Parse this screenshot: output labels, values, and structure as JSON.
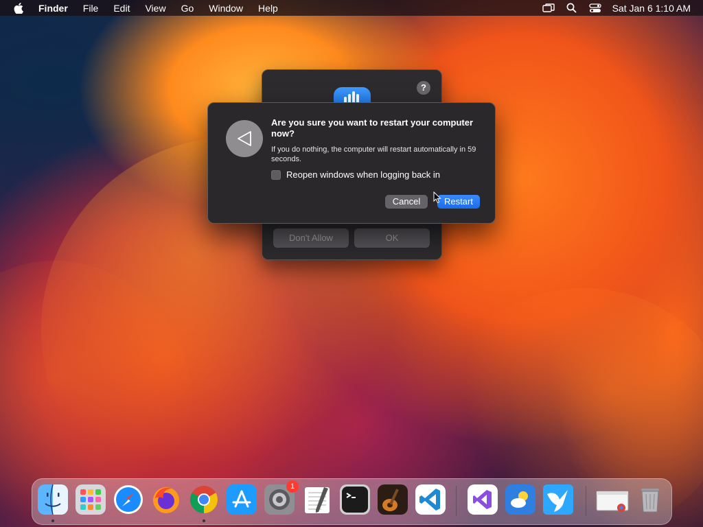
{
  "menubar": {
    "app_name": "Finder",
    "menus": [
      "File",
      "Edit",
      "View",
      "Go",
      "Window",
      "Help"
    ],
    "datetime": "Sat Jan 6  1:10 AM"
  },
  "background_dialog": {
    "help_label": "?",
    "dont_allow_label": "Don't Allow",
    "ok_label": "OK"
  },
  "restart_dialog": {
    "title": "Are you sure you want to restart your computer now?",
    "message": "If you do nothing, the computer will restart automatically in 59 seconds.",
    "checkbox_label": "Reopen windows when logging back in",
    "checkbox_checked": false,
    "cancel_label": "Cancel",
    "restart_label": "Restart"
  },
  "dock": {
    "apps": [
      {
        "name": "Finder",
        "running": true
      },
      {
        "name": "Launchpad",
        "running": false
      },
      {
        "name": "Safari",
        "running": false
      },
      {
        "name": "Firefox",
        "running": false
      },
      {
        "name": "Google Chrome",
        "running": true
      },
      {
        "name": "App Store",
        "running": false
      },
      {
        "name": "System Settings",
        "running": false,
        "badge": "1"
      },
      {
        "name": "TextEdit",
        "running": false
      },
      {
        "name": "Terminal",
        "running": false
      },
      {
        "name": "GarageBand",
        "running": false
      },
      {
        "name": "Visual Studio Code",
        "running": false
      },
      {
        "name": "Visual Studio",
        "running": false
      },
      {
        "name": "Weather",
        "running": false
      },
      {
        "name": "Hummingbird",
        "running": false
      },
      {
        "name": "Chrome Window",
        "running": false
      },
      {
        "name": "Trash",
        "running": false
      }
    ]
  },
  "colors": {
    "accent": "#1a6ce8",
    "dialog_bg": "#2a282b",
    "badge": "#ff3b30"
  }
}
